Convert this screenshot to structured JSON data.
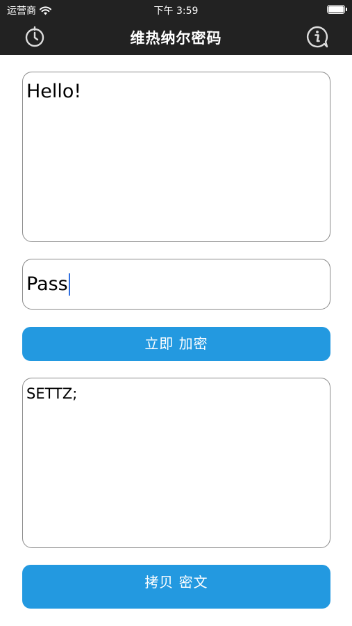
{
  "status_bar": {
    "carrier": "运营商",
    "time": "下午 3:59"
  },
  "nav": {
    "title": "维热纳尔密码",
    "left_icon": "timer-icon",
    "right_icon": "info-icon"
  },
  "plaintext": {
    "value": "Hello!"
  },
  "key": {
    "value": "Pass"
  },
  "encrypt_button": {
    "label": "立即 加密"
  },
  "ciphertext": {
    "value": "SETTZ;"
  },
  "copy_button": {
    "label": "拷贝 密文"
  },
  "colors": {
    "bar_background": "#222222",
    "button_blue": "#2399e0",
    "caret_blue": "#2f6fe0",
    "border_gray": "#8a8a8a"
  }
}
